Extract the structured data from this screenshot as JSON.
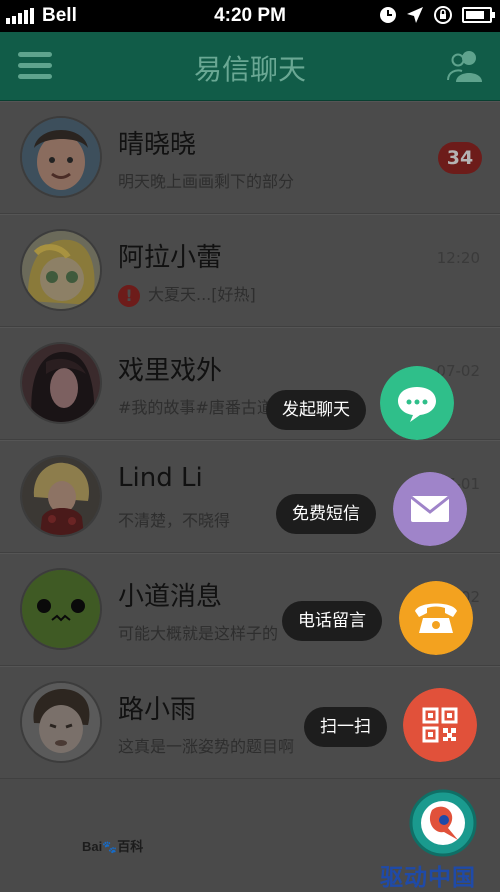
{
  "status_bar": {
    "carrier": "Bell",
    "time": "4:20 PM"
  },
  "header": {
    "title": "易信聊天",
    "menu_icon": "hamburger-menu-icon",
    "contacts_icon": "contacts-icon"
  },
  "chats": [
    {
      "name": "晴晓晓",
      "preview": "明天晚上画画剩下的部分",
      "meta": "",
      "badge": "34"
    },
    {
      "name": "阿拉小蕾",
      "preview": "大夏天...[好热]",
      "meta": "12:20",
      "warning": true
    },
    {
      "name": "戏里戏外",
      "preview": "#我的故事#唐番古道",
      "meta": "07-02"
    },
    {
      "name": "Lind Li",
      "preview": "不清楚，不晓得",
      "meta": "07-01"
    },
    {
      "name": "小道消息",
      "preview": "可能大概就是这样子的",
      "meta": "07-02"
    },
    {
      "name": "路小雨",
      "preview": "这真是一涨姿势的题目啊",
      "meta": ""
    }
  ],
  "fab_menu": [
    {
      "label": "发起聊天",
      "icon": "chat-bubble-icon",
      "color": "#2fbf8a"
    },
    {
      "label": "免费短信",
      "icon": "envelope-icon",
      "color": "#9f84c9"
    },
    {
      "label": "电话留言",
      "icon": "telephone-icon",
      "color": "#f3a21f"
    },
    {
      "label": "扫一扫",
      "icon": "qr-code-icon",
      "color": "#e1513a"
    }
  ],
  "watermarks": {
    "baidu": "Baiбаike",
    "brand": "驱动中国"
  }
}
